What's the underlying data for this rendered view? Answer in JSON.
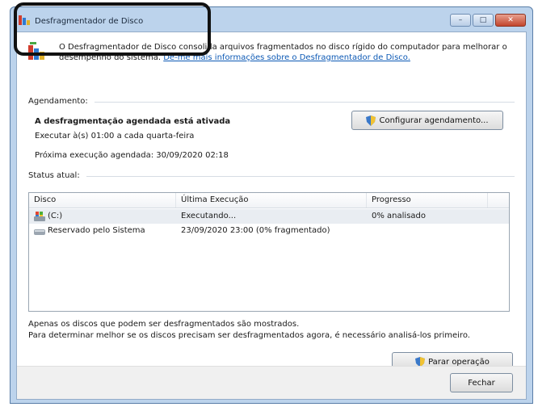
{
  "window": {
    "title": "Desfragmentador de Disco",
    "controls": {
      "minimize": "–",
      "maximize": "□",
      "close": "✕"
    }
  },
  "intro": {
    "text": "O Desfragmentador de Disco consolida arquivos fragmentados no disco rígido do computador para melhorar o desempenho do sistema.",
    "link": "Dê-me mais informações sobre o Desfragmentador de Disco."
  },
  "schedule": {
    "section_label": "Agendamento:",
    "status": "A desfragmentação agendada está ativada",
    "run_line": "Executar à(s) 01:00 a cada quarta-feira",
    "next_run": "Próxima execução agendada: 30/09/2020 02:18",
    "configure_button": "Configurar agendamento..."
  },
  "status": {
    "section_label": "Status atual:",
    "columns": [
      "Disco",
      "Última Execução",
      "Progresso"
    ],
    "rows": [
      {
        "disk": "(C:)",
        "last_run": "Executando...",
        "progress": "0% analisado",
        "icon": "windows-drive-icon"
      },
      {
        "disk": "Reservado pelo Sistema",
        "last_run": "23/09/2020 23:00 (0% fragmentado)",
        "progress": "",
        "icon": "drive-icon"
      }
    ]
  },
  "notes": {
    "line1": "Apenas os discos que podem ser desfragmentados são mostrados.",
    "line2": "Para determinar melhor se os discos precisam ser desfragmentados agora, é necessário analisá-los primeiro."
  },
  "actions": {
    "stop_button": "Parar operação",
    "close_button": "Fechar"
  },
  "colors": {
    "accent_link": "#0c59b5",
    "window_frame": "#bcd3ec",
    "annotation": "#111111"
  }
}
